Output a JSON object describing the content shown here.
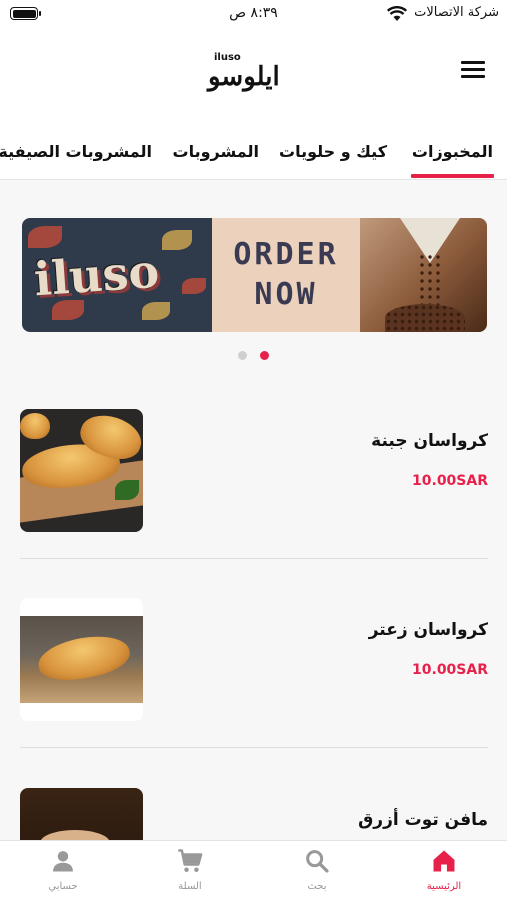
{
  "status_bar": {
    "carrier": "شركة الاتصالات",
    "time": "٨:٣٩ ص"
  },
  "header": {
    "logo_latin": "iluso",
    "logo_arabic": "ايلوسو"
  },
  "tabs": [
    {
      "label": "المخبوزات",
      "active": true
    },
    {
      "label": "كيك و حلويات",
      "active": false
    },
    {
      "label": "المشروبات",
      "active": false
    },
    {
      "label": "المشروبات الصيفية",
      "active": false
    }
  ],
  "banner": {
    "brand_text": "iluso",
    "cta_line1": "ORDER",
    "cta_line2": "NOW"
  },
  "carousel": {
    "slide_count": 2,
    "active_index": 1
  },
  "products": [
    {
      "name": "كرواسان جبنة",
      "price": "10.00SAR"
    },
    {
      "name": "كرواسان زعتر",
      "price": "10.00SAR"
    },
    {
      "name": "مافن توت أزرق",
      "price": ""
    }
  ],
  "bottom_nav": [
    {
      "label": "الرئيسية",
      "icon": "home-icon",
      "active": true
    },
    {
      "label": "بحث",
      "icon": "search-icon",
      "active": false
    },
    {
      "label": "السلة",
      "icon": "cart-icon",
      "active": false
    },
    {
      "label": "حسابي",
      "icon": "user-icon",
      "active": false
    }
  ],
  "colors": {
    "accent": "#e8214a",
    "background": "#f7f7f7",
    "inactive_nav": "#999999"
  }
}
